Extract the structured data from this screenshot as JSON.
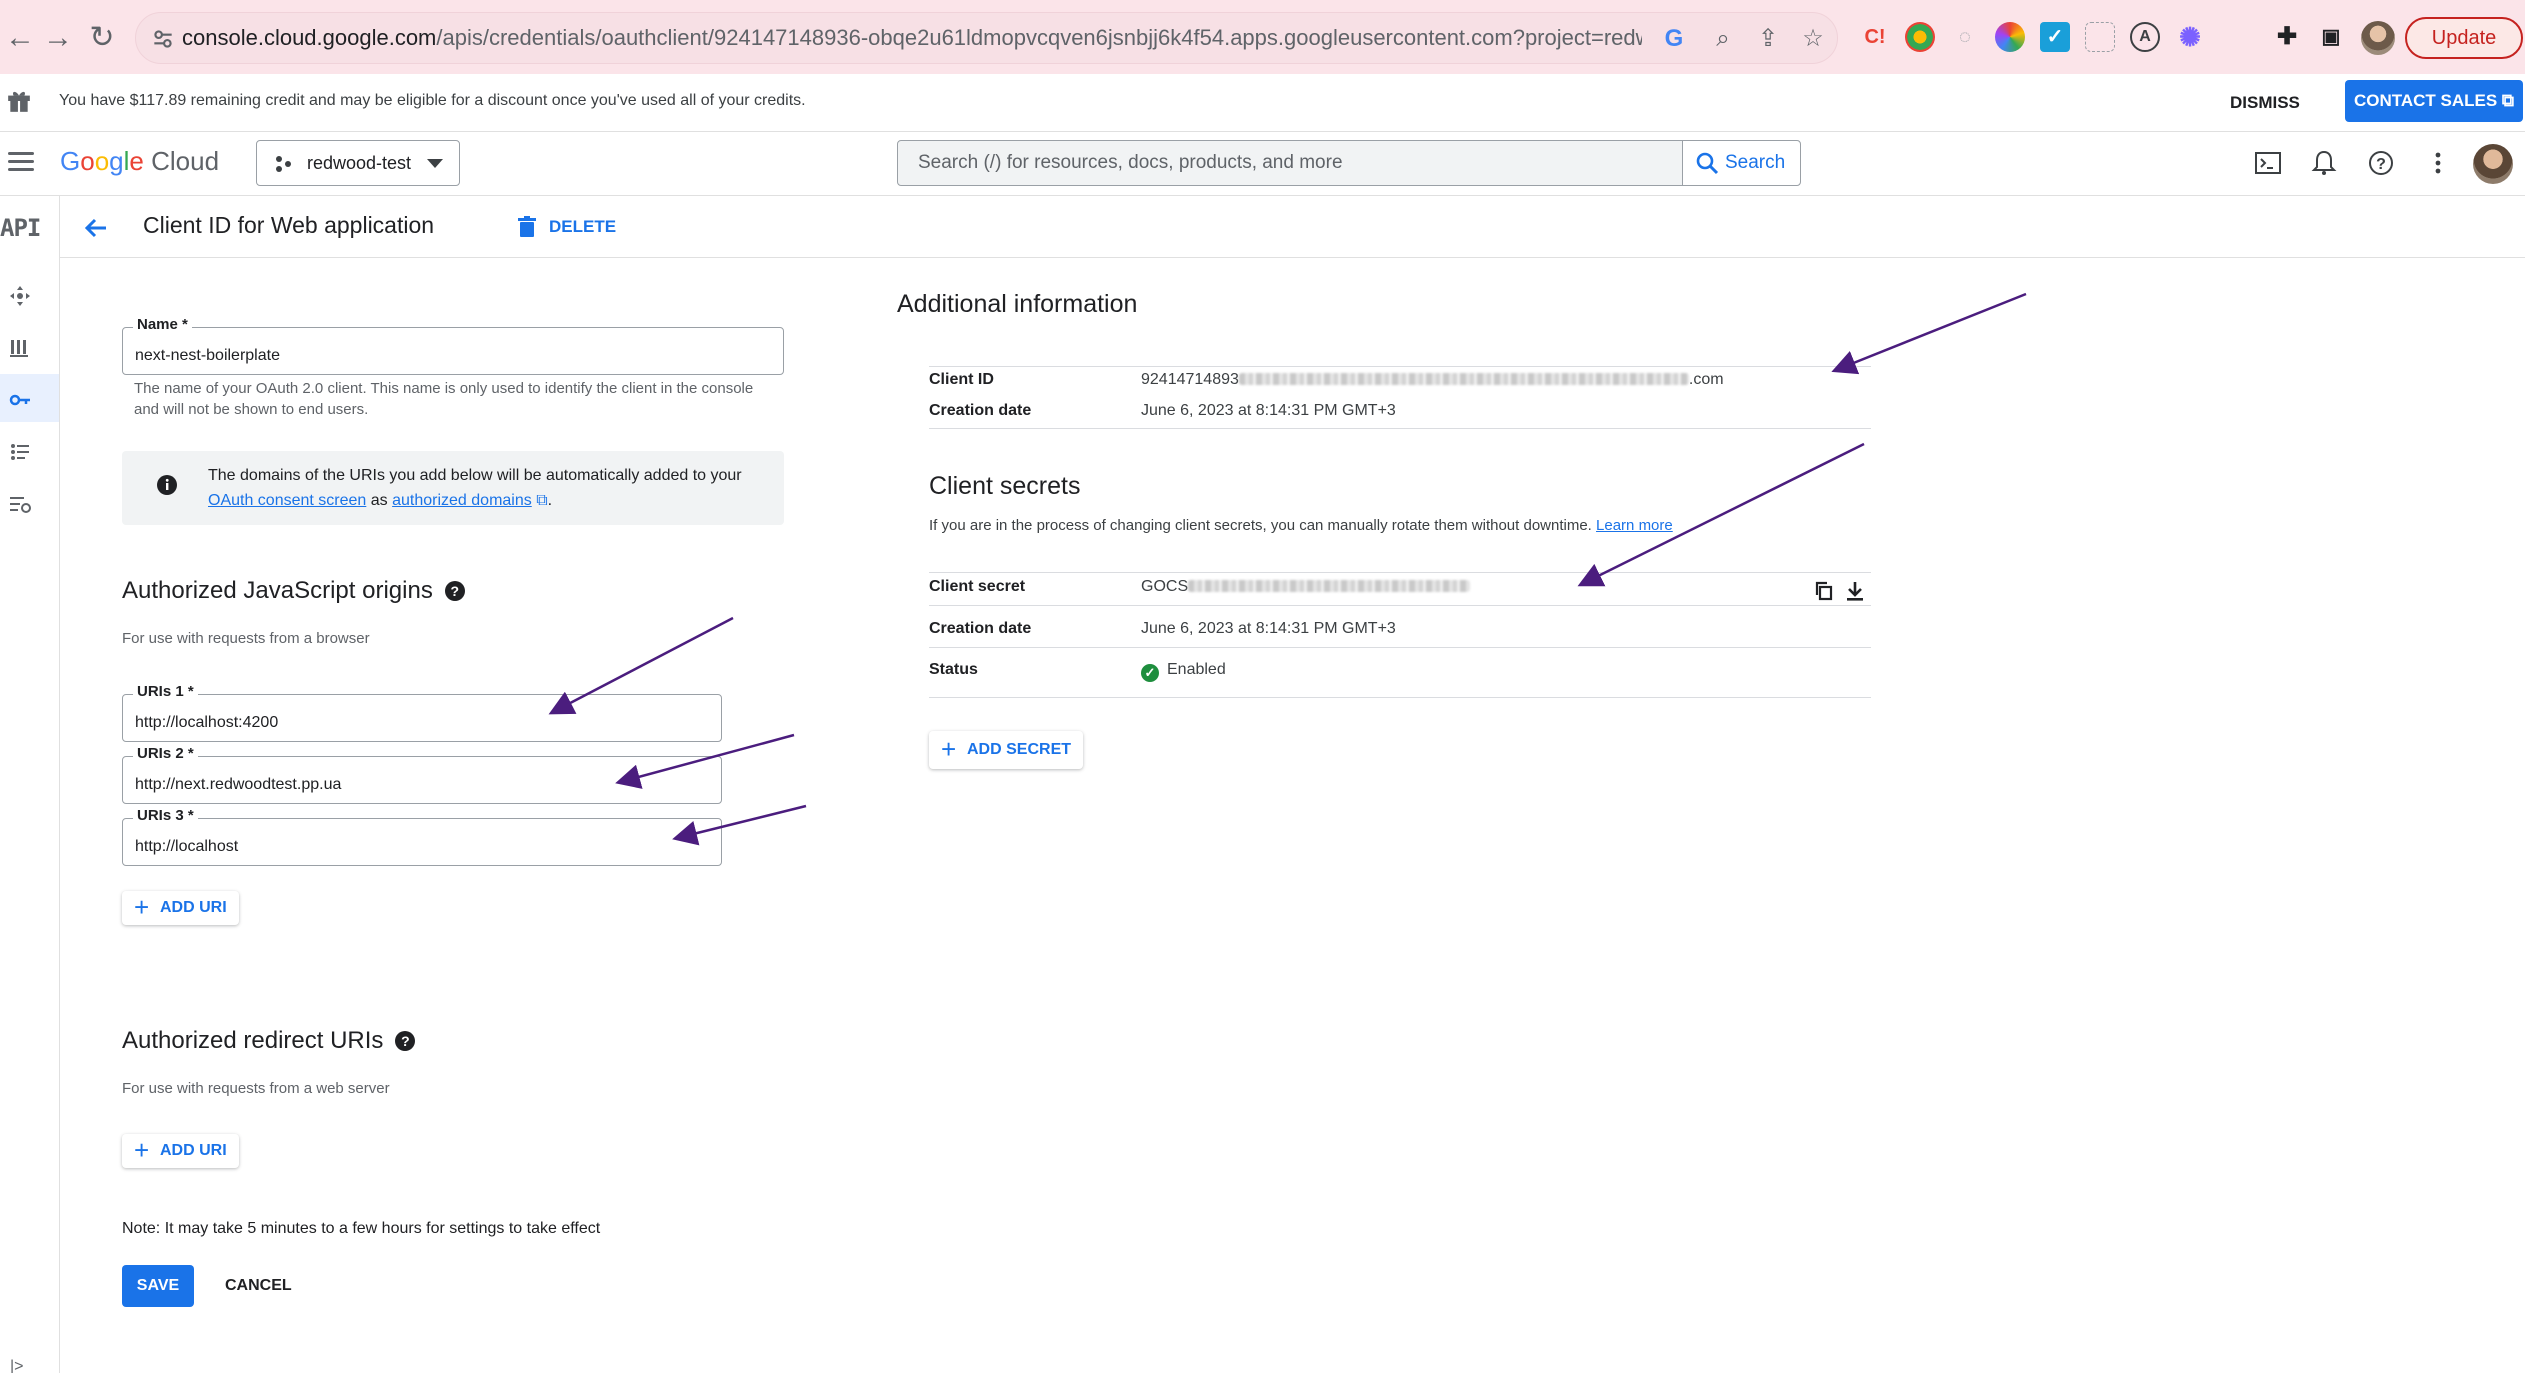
{
  "browser": {
    "url_host": "console.cloud.google.com",
    "url_path": "/apis/credentials/oauthclient/924147148936-obqe2u61ldmopvcqven6jsnbjj6k4f54.apps.googleusercontent.com?project=redwood-test...",
    "update_label": "Update"
  },
  "promo": {
    "text": "You have $117.89 remaining credit and may be eligible for a discount once you've used all of your credits.",
    "dismiss_label": "DISMISS",
    "contact_label": "CONTACT SALES"
  },
  "header": {
    "logo_google": [
      "G",
      "o",
      "o",
      "g",
      "l",
      "e"
    ],
    "logo_cloud": "Cloud",
    "project_name": "redwood-test",
    "search_placeholder": "Search (/) for resources, docs, products, and more",
    "search_button": "Search"
  },
  "rail": {
    "api_label": "API"
  },
  "titlebar": {
    "title": "Client ID for Web application",
    "delete_label": "DELETE"
  },
  "form": {
    "name_label": "Name *",
    "name_value": "next-nest-boilerplate",
    "name_hint": "The name of your OAuth 2.0 client. This name is only used to identify the client in the console and will not be shown to end users.",
    "info_text_1": "The domains of the URIs you add below will be automatically added to your ",
    "info_link_1": "OAuth consent screen",
    "info_text_2": " as ",
    "info_link_2": "authorized domains",
    "info_text_3": ".",
    "js_origins_title": "Authorized JavaScript origins",
    "js_origins_hint": "For use with requests from a browser",
    "uris": [
      {
        "label": "URIs 1 *",
        "value": "http://localhost:4200"
      },
      {
        "label": "URIs 2 *",
        "value": "http://next.redwoodtest.pp.ua"
      },
      {
        "label": "URIs 3 *",
        "value": "http://localhost"
      }
    ],
    "add_uri_label": "ADD URI",
    "redirect_title": "Authorized redirect URIs",
    "redirect_hint": "For use with requests from a web server",
    "note": "Note: It may take 5 minutes to a few hours for settings to take effect",
    "save_label": "SAVE",
    "cancel_label": "CANCEL"
  },
  "additional": {
    "title": "Additional information",
    "client_id_label": "Client ID",
    "client_id_prefix": "92414714893",
    "client_id_suffix": ".com",
    "creation_label": "Creation date",
    "creation_value": "June 6, 2023 at 8:14:31 PM GMT+3"
  },
  "secrets": {
    "title": "Client secrets",
    "desc": "If you are in the process of changing client secrets, you can manually rotate them without downtime. ",
    "learn_more": "Learn more",
    "secret_label": "Client secret",
    "secret_prefix": "GOCS",
    "creation_label": "Creation date",
    "creation_value": "June 6, 2023 at 8:14:31 PM GMT+3",
    "status_label": "Status",
    "status_value": "Enabled",
    "add_secret_label": "ADD SECRET"
  },
  "colors": {
    "accent": "#1a73e8",
    "annotation_arrow": "#4b1d7e",
    "status_green": "#1e8e3e"
  }
}
